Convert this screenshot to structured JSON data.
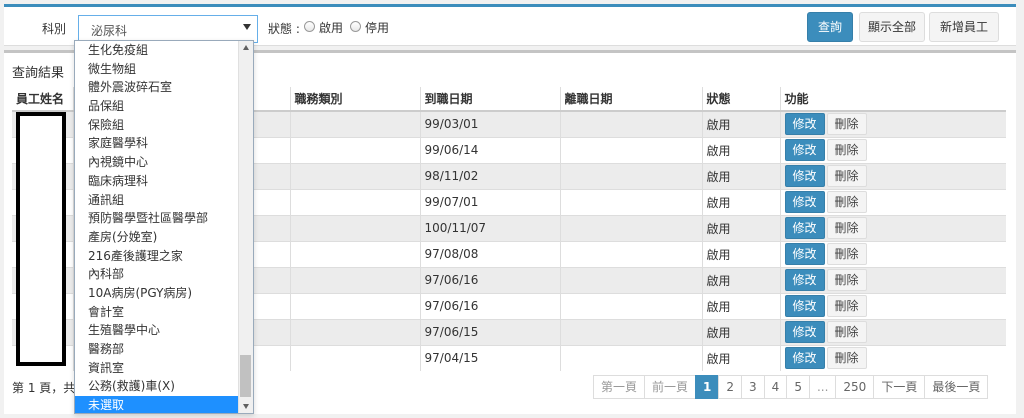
{
  "filter": {
    "dept_label": "科別",
    "dept_selected": "泌尿科",
    "status_label": "狀態 :",
    "status_options": [
      "啟用",
      "停用"
    ],
    "search_button": "查詢",
    "show_all_button": "顯示全部",
    "add_employee_button": "新增員工"
  },
  "dropdown": {
    "options": [
      "生化免疫組",
      "微生物組",
      "體外震波碎石室",
      "品保組",
      "保險組",
      "家庭醫學科",
      "內視鏡中心",
      "臨床病理科",
      "通訊組",
      "預防醫學暨社區醫學部",
      "產房(分娩室)",
      "216產後護理之家",
      "內科部",
      "10A病房(PGY病房)",
      "會計室",
      "生殖醫學中心",
      "醫務部",
      "資訊室",
      "公務(救護)車(X)",
      "未選取"
    ],
    "selected_option": "未選取"
  },
  "results": {
    "title": "查詢結果",
    "columns": [
      "員工姓名",
      "",
      "職務類別",
      "到職日期",
      "離職日期",
      "狀態",
      "功能"
    ],
    "edit_label": "修改",
    "delete_label": "刪除",
    "rows": [
      {
        "hire_date": "99/03/01",
        "status": "啟用"
      },
      {
        "hire_date": "99/06/14",
        "status": "啟用"
      },
      {
        "hire_date": "98/11/02",
        "status": "啟用"
      },
      {
        "hire_date": "99/07/01",
        "status": "啟用"
      },
      {
        "hire_date": "100/11/07",
        "status": "啟用"
      },
      {
        "hire_date": "97/08/08",
        "status": "啟用"
      },
      {
        "hire_date": "97/06/16",
        "status": "啟用"
      },
      {
        "hire_date": "97/06/16",
        "status": "啟用"
      },
      {
        "hire_date": "97/06/15",
        "status": "啟用"
      },
      {
        "hire_date": "97/04/15",
        "status": "啟用"
      }
    ],
    "page_info": "第 1 頁，共"
  },
  "pagination": {
    "first": "第一頁",
    "prev": "前一頁",
    "pages": [
      "1",
      "2",
      "3",
      "4",
      "5",
      "...",
      "250"
    ],
    "current": "1",
    "next": "下一頁",
    "last": "最後一頁"
  },
  "colors": {
    "primary": "#3c8dbc",
    "selected_option": "#1e90ff",
    "odd_row": "#ececec"
  }
}
